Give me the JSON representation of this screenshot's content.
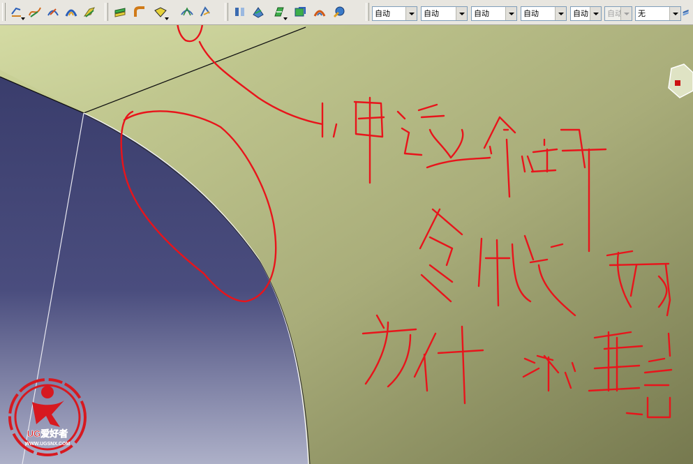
{
  "toolbar": {
    "icons": [
      {
        "name": "curve-sketch-icon"
      },
      {
        "name": "spline-curve-icon"
      },
      {
        "name": "connect-curve-icon"
      },
      {
        "name": "sweep-surface-icon"
      },
      {
        "name": "blend-surface-icon"
      },
      {
        "name": "offset-surface-icon"
      },
      {
        "name": "fillet-surface-icon"
      },
      {
        "name": "fill-surface-icon"
      },
      {
        "name": "net-surface-icon"
      },
      {
        "name": "trim-surface-icon"
      },
      {
        "name": "extract-geometry-icon"
      },
      {
        "name": "join-surface-icon"
      },
      {
        "name": "healing-icon"
      },
      {
        "name": "untrim-icon"
      },
      {
        "name": "disassemble-icon"
      },
      {
        "name": "analysis-icon"
      }
    ],
    "combos": [
      {
        "value": "自动",
        "disabled": false
      },
      {
        "value": "自动",
        "disabled": false
      },
      {
        "value": "自动",
        "disabled": false
      },
      {
        "value": "自动",
        "disabled": false
      },
      {
        "value": "自动",
        "disabled": false
      },
      {
        "value": "自动",
        "disabled": true
      },
      {
        "value": "无",
        "disabled": false
      }
    ]
  },
  "logo": {
    "text_main": "UG爱好者",
    "text_url": "WWW.UGSNX.COM"
  },
  "colors": {
    "surface_light": "#cdd59a",
    "surface_dark": "#7d805c",
    "disc_top": "#3c3f6e",
    "disc_bottom": "#a9acc6",
    "annotation": "#e8141b",
    "toolbar_bg": "#e8e6e0"
  }
}
